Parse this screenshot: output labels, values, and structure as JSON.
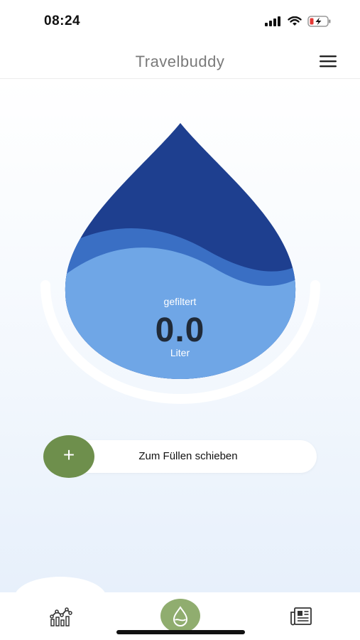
{
  "status_bar": {
    "time": "08:24",
    "icons": [
      "signal-icon",
      "wifi-icon",
      "battery-charging-icon"
    ]
  },
  "header": {
    "title": "Travelbuddy",
    "menu_icon": "hamburger-menu-icon"
  },
  "gauge": {
    "label": "gefiltert",
    "value": "0.0",
    "unit": "Liter",
    "fill_level": 0.0
  },
  "fill_slider": {
    "label": "Zum Füllen schieben",
    "knob_symbol": "+",
    "knob_color": "#6e8f4c"
  },
  "tab_bar": {
    "items": [
      {
        "icon": "statistics-chart-icon",
        "active": false
      },
      {
        "icon": "water-drop-icon",
        "active": true
      },
      {
        "icon": "newspaper-icon",
        "active": false
      }
    ],
    "active_color": "#90ad6f"
  },
  "colors": {
    "drop_dark": "#1e3f8f",
    "drop_mid": "#3a6fc4",
    "drop_light": "#6fa6e6",
    "accent_green": "#6e8f4c"
  }
}
